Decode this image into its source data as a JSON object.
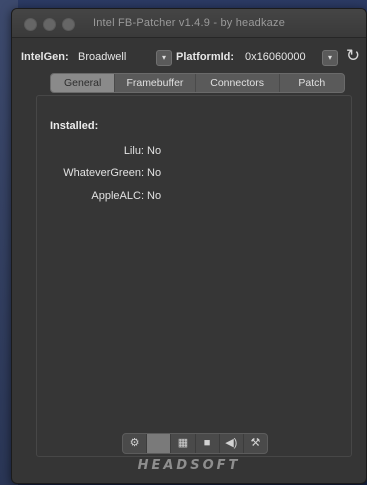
{
  "window": {
    "title": "Intel FB-Patcher v1.4.9 - by headkaze"
  },
  "controls": {
    "intelgen_label": "IntelGen:",
    "intelgen_value": "Broadwell",
    "platformid_label": "PlatformId:",
    "platformid_value": "0x16060000",
    "refresh_glyph": "↻"
  },
  "tabs": [
    {
      "label": "General",
      "active": true
    },
    {
      "label": "Framebuffer",
      "active": false
    },
    {
      "label": "Connectors",
      "active": false
    },
    {
      "label": "Patch",
      "active": false
    }
  ],
  "installed": {
    "title": "Installed:",
    "items": [
      {
        "label": "Lilu:",
        "value": "No"
      },
      {
        "label": "WhateverGreen:",
        "value": "No"
      },
      {
        "label": "AppleALC:",
        "value": "No"
      }
    ]
  },
  "bottom_bar": [
    {
      "icon": "gear-icon",
      "glyph": "⚙",
      "active": false
    },
    {
      "icon": "display-icon",
      "glyph": "",
      "active": true
    },
    {
      "icon": "grid-icon",
      "glyph": "▦",
      "active": false
    },
    {
      "icon": "stop-icon",
      "glyph": "■",
      "active": false
    },
    {
      "icon": "speaker-icon",
      "glyph": "◀)",
      "active": false
    },
    {
      "icon": "tools-icon",
      "glyph": "⚒",
      "active": false
    }
  ],
  "brand": "HEADSOFT",
  "colors": {
    "window_bg": "#353535",
    "active_tab": "#8a8a8a",
    "desktop": "#1d2a4e"
  }
}
